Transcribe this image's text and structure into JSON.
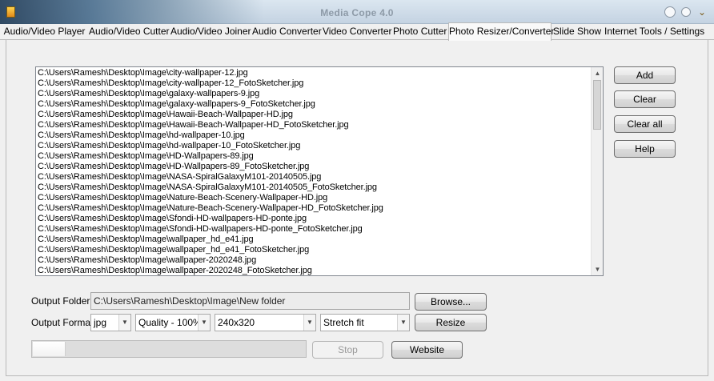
{
  "window": {
    "title": "Media Cope 4.0",
    "close_glyph": "⌄"
  },
  "tabs": [
    {
      "label": "Audio/Video Player"
    },
    {
      "label": "Audio/Video Cutter"
    },
    {
      "label": "Audio/Video Joiner"
    },
    {
      "label": "Audio Converter"
    },
    {
      "label": "Video Converter"
    },
    {
      "label": "Photo Cutter"
    },
    {
      "label": "Photo Resizer/Converter",
      "active": true
    },
    {
      "label": "Slide Show"
    },
    {
      "label": "Internet Tools / Settings"
    }
  ],
  "file_list": [
    "C:\\Users\\Ramesh\\Desktop\\Image\\city-wallpaper-12.jpg",
    "C:\\Users\\Ramesh\\Desktop\\Image\\city-wallpaper-12_FotoSketcher.jpg",
    "C:\\Users\\Ramesh\\Desktop\\Image\\galaxy-wallpapers-9.jpg",
    "C:\\Users\\Ramesh\\Desktop\\Image\\galaxy-wallpapers-9_FotoSketcher.jpg",
    "C:\\Users\\Ramesh\\Desktop\\Image\\Hawaii-Beach-Wallpaper-HD.jpg",
    "C:\\Users\\Ramesh\\Desktop\\Image\\Hawaii-Beach-Wallpaper-HD_FotoSketcher.jpg",
    "C:\\Users\\Ramesh\\Desktop\\Image\\hd-wallpaper-10.jpg",
    "C:\\Users\\Ramesh\\Desktop\\Image\\hd-wallpaper-10_FotoSketcher.jpg",
    "C:\\Users\\Ramesh\\Desktop\\Image\\HD-Wallpapers-89.jpg",
    "C:\\Users\\Ramesh\\Desktop\\Image\\HD-Wallpapers-89_FotoSketcher.jpg",
    "C:\\Users\\Ramesh\\Desktop\\Image\\NASA-SpiralGalaxyM101-20140505.jpg",
    "C:\\Users\\Ramesh\\Desktop\\Image\\NASA-SpiralGalaxyM101-20140505_FotoSketcher.jpg",
    "C:\\Users\\Ramesh\\Desktop\\Image\\Nature-Beach-Scenery-Wallpaper-HD.jpg",
    "C:\\Users\\Ramesh\\Desktop\\Image\\Nature-Beach-Scenery-Wallpaper-HD_FotoSketcher.jpg",
    "C:\\Users\\Ramesh\\Desktop\\Image\\Sfondi-HD-wallpapers-HD-ponte.jpg",
    "C:\\Users\\Ramesh\\Desktop\\Image\\Sfondi-HD-wallpapers-HD-ponte_FotoSketcher.jpg",
    "C:\\Users\\Ramesh\\Desktop\\Image\\wallpaper_hd_e41.jpg",
    "C:\\Users\\Ramesh\\Desktop\\Image\\wallpaper_hd_e41_FotoSketcher.jpg",
    "C:\\Users\\Ramesh\\Desktop\\Image\\wallpaper-2020248.jpg",
    "C:\\Users\\Ramesh\\Desktop\\Image\\wallpaper-2020248_FotoSketcher.jpg"
  ],
  "side_buttons": {
    "add": "Add",
    "clear": "Clear",
    "clear_all": "Clear all",
    "help": "Help"
  },
  "output_folder": {
    "label": "Output Folder",
    "value": "C:\\Users\\Ramesh\\Desktop\\Image\\New folder",
    "browse": "Browse..."
  },
  "output_format": {
    "label": "Output Format",
    "format": "jpg",
    "quality": "Quality - 100%",
    "size": "240x320",
    "fit": "Stretch fit",
    "resize": "Resize"
  },
  "progress": {
    "fraction": 0.12
  },
  "bottom_buttons": {
    "stop": "Stop",
    "website": "Website"
  },
  "icons": {
    "scroll_up": "▲",
    "scroll_down": "▼",
    "dropdown": "▼"
  }
}
